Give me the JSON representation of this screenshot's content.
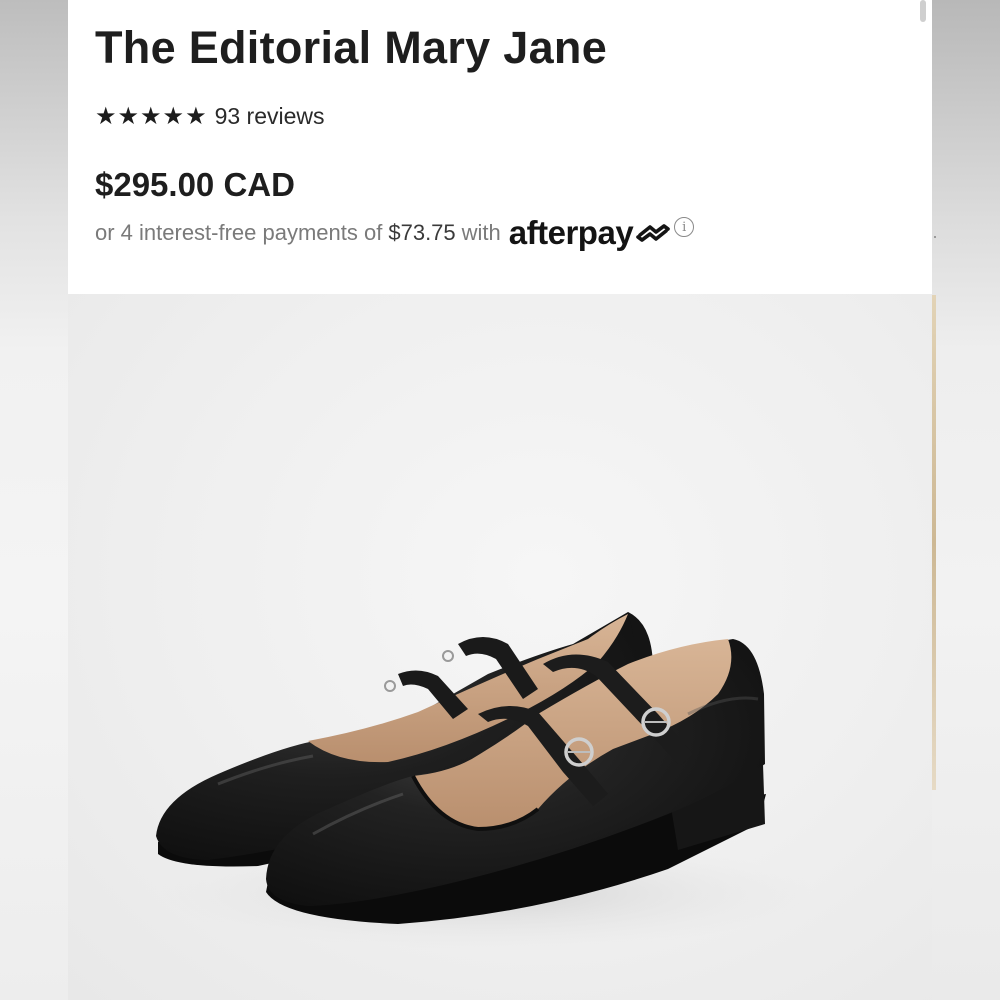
{
  "product": {
    "title": "The Editorial Mary Jane",
    "rating": {
      "stars": 5,
      "star_glyph": "★",
      "review_count_text": "93 reviews"
    },
    "price": "$295.00 CAD",
    "installments": {
      "prefix": "or 4 interest-free payments of",
      "amount": "$73.75",
      "suffix": "with",
      "provider": "afterpay",
      "provider_icon": "afterpay-arrows-icon",
      "info_icon": "info-icon",
      "info_glyph": "i"
    }
  },
  "image": {
    "subject": "black-leather-mary-jane-shoes-pair"
  },
  "colors": {
    "text_primary": "#1e1e1e",
    "text_muted": "#7a7a7a",
    "panel_bg": "#ffffff",
    "image_bg": "#efefef",
    "leather": "#1f1f1f",
    "lining": "#c9a584"
  }
}
